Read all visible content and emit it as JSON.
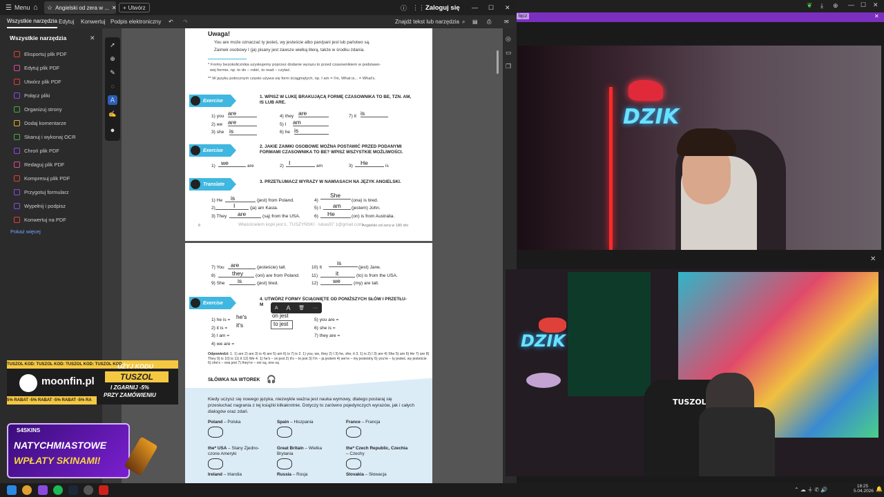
{
  "titlebar": {
    "menu_label": "Menu",
    "tab_title": "Angielski od zera w ...",
    "new_tab_label": "Utwórz",
    "sign_in": "Zaloguj się"
  },
  "menubar": {
    "items": [
      "Wszystkie narzędzia",
      "Edytuj",
      "Konwertuj",
      "Podpis elektroniczny"
    ],
    "search_label": "Znajdź tekst lub narzędzia"
  },
  "sidepanel": {
    "title": "Wszystkie narzędzia",
    "tools": [
      {
        "label": "Eksportuj plik PDF",
        "color": "#e0403a"
      },
      {
        "label": "Edytuj plik PDF",
        "color": "#e04a8a"
      },
      {
        "label": "Utwórz plik PDF",
        "color": "#e0403a"
      },
      {
        "label": "Połącz pliki",
        "color": "#8a4ae0"
      },
      {
        "label": "Organizuj strony",
        "color": "#4aa84a"
      },
      {
        "label": "Dodaj komentarze",
        "color": "#e0b030"
      },
      {
        "label": "Skanuj i wykonaj OCR",
        "color": "#4aa84a"
      },
      {
        "label": "Chroń plik PDF",
        "color": "#8a4ae0"
      },
      {
        "label": "Redaguj plik PDF",
        "color": "#e04a8a"
      },
      {
        "label": "Kompresuj plik PDF",
        "color": "#e0403a"
      },
      {
        "label": "Przygotuj formularz",
        "color": "#8a4ae0"
      },
      {
        "label": "Wypełnij i podpisz",
        "color": "#8a4ae0"
      },
      {
        "label": "Konwertuj na PDF",
        "color": "#e0403a"
      }
    ],
    "more_label": "Pokaż więcej"
  },
  "page1": {
    "heading": "Uwaga!",
    "bullet1": "You are może oznaczać ty jesteś, wy jesteście albo pan/pani jest lub państwo są.",
    "bullet2": "Zaimek osobowy I (ja) pisany jest zawsze wielką literą, także w środku zdania.",
    "note1": "* Formy bezokolicznika uzyskujemy poprzez dodanie wyrazu to przed czasownikiem w podstawo-",
    "note1b": "wej formie, np. to do – robić, to read – czytać.",
    "note2": "** W języku potocznym często używa się form ściągniętych, np. I am = I'm, What is... = What's.",
    "exercise_label": "Exercise",
    "translate_label": "Translate",
    "task1": "1.  WPISZ W LUKĘ BRAKUJĄCĄ FORMĘ CZASOWNIKA TO BE, TZN. AM, IS LUB ARE.",
    "task2": "2.  JAKIE ZAIMKI OSOBOWE MOŻNA POSTAWIĆ PRZED PODANYMI FORMAMI CZASOWNIKA TO BE? WPISZ WSZYSTKIE MOŻLIWOŚCI.",
    "task3": "3.  PRZETŁUMACZ WYRAZY W NAWIASACH NA JĘZYK ANGIELSKI.",
    "ex1_rows": [
      "1)  you",
      "2)  we",
      "3)  she",
      "4)  they",
      "5)  I",
      "6)  he",
      "7)  it"
    ],
    "ex1_answers": [
      "are",
      "are",
      "is",
      "are",
      "am",
      "is",
      "is"
    ],
    "ex2_rows": [
      "1)",
      "are",
      "2)",
      "am",
      "3)",
      "is"
    ],
    "ex2_answers": [
      "we",
      "I",
      "He"
    ],
    "ex3_rows": [
      "1)  He",
      "(jest) from Poland.",
      "2)",
      "(ja) am Kasia.",
      "3)  They",
      "(są) from the USA.",
      "4)",
      "(ona) is tired.",
      "5)  I",
      "(jestem) John.",
      "6)",
      "(on) is from Australia."
    ],
    "ex3_answers": [
      "is",
      "I",
      "are",
      "She",
      "am",
      "He"
    ],
    "footer_page": "8",
    "footer_watermark": "Właścicielem kopii jest Ł. TUSZYŃSKI · lukas97 1@gmail.com",
    "footer_title": "Angielski od zera w 180 dni"
  },
  "page2": {
    "rows_left": [
      "7)  You",
      "(jesteście) tall.",
      "8)",
      "(oni) are from Poland.",
      "9)  She",
      "(jest) tired."
    ],
    "rows_right": [
      "10)  It",
      "(jest) Jane.",
      "11)",
      "(to) is from the USA.",
      "12)",
      "(my) are tall."
    ],
    "answers": [
      "are",
      "they",
      "is",
      "is",
      "it",
      "we"
    ],
    "exercise_label": "Exercise",
    "task4": "4.  UTWÓRZ FORMY ŚCIĄGNIĘTE OD PONIŻSZYCH SŁÓW I PRZETŁU-",
    "task4b": "M                                        SKI.",
    "ex4_left": [
      "1)  he is =",
      "2)  it is =",
      "3)  I am =",
      "4)  we are ="
    ],
    "ex4_right": [
      "5)  you are =",
      "6)  she is =",
      "7)  they are ="
    ],
    "ex4_answers": [
      "he's",
      "it's"
    ],
    "ex4_notes": [
      "on jest",
      "to jest"
    ],
    "answers_label": "Odpowiedzi:",
    "answers_text": "1. 1) are 2) are 3) is 4) are 5) am 6) is 7) is 2. 1) you, we, they 2) I 3) he, she, it 3. 1) is 2) I 3) are 4) She 5) am 6) He 7) are 8) They 9) is 10) is 11) it 12) We 4. 1) he's – on jest 2) it's – to jest 3) I'm – ja jestem 4) we're – my jesteśmy 5) you're – ty jesteś, wy jesteście 6) she's – ona jest 7) they're – oni są, one są",
    "vocab_title": "SŁÓWKA NA WTOREK",
    "vocab_intro": "Kiedy uczysz się nowego języka, niezwykle ważna jest nauka wymowy, dlatego postaraj się przesłuchać nagrania z tej książki kilkakrotnie. Dotyczy to zarówno pojedynczych wyrazów, jak i całych dialogów oraz zdań.",
    "vocab": [
      {
        "en": "Poland",
        "pl": "– Polska"
      },
      {
        "en": "Spain",
        "pl": "– Hiszpania"
      },
      {
        "en": "France",
        "pl": "– Francja"
      },
      {
        "en": "the* USA",
        "pl": "– Stany Zjedno-czone Ameryki"
      },
      {
        "en": "Great Britain",
        "pl": "– Wielka Brytania"
      },
      {
        "en": "the* Czech Republic, Czechia",
        "pl": "– Czechy"
      },
      {
        "en": "Ireland",
        "pl": "– Irlandia"
      },
      {
        "en": "Russia",
        "pl": "– Rosja"
      },
      {
        "en": "Slovakia",
        "pl": "– Słowacja"
      }
    ]
  },
  "stream": {
    "ad_button": "łącz",
    "neon_top": "DZIK",
    "neon_bottom": "DZIK",
    "chair_label": "TUSZOL",
    "moonfin_strip": "TUSZOL KOD: TUSZOL KOD: TUSZOL KOD: TUSZOL KOD",
    "moonfin_brand": "moonfin.pl",
    "moonfin_use": "UŻYJ KODU",
    "moonfin_code": "TUSZOL",
    "moonfin_gain": "I ZGARNIJ -5%",
    "moonfin_order": "PRZY ZAMÓWIENIU",
    "moonfin_bottom": "5% RABAT -5% RABAT -5% RABAT -5% RA",
    "skins_brand": "S4SKINS",
    "skins_line1": "NATYCHMIASTOWE",
    "skins_line2": "WPŁATY SKINAMI!"
  },
  "taskbar": {
    "time": "18:25",
    "date": "5.04.2026"
  },
  "colors": {
    "exercise_blue": "#3fb7e0",
    "vocab_bg": "#dcecf7",
    "stream_purple": "#7b2fbf"
  }
}
